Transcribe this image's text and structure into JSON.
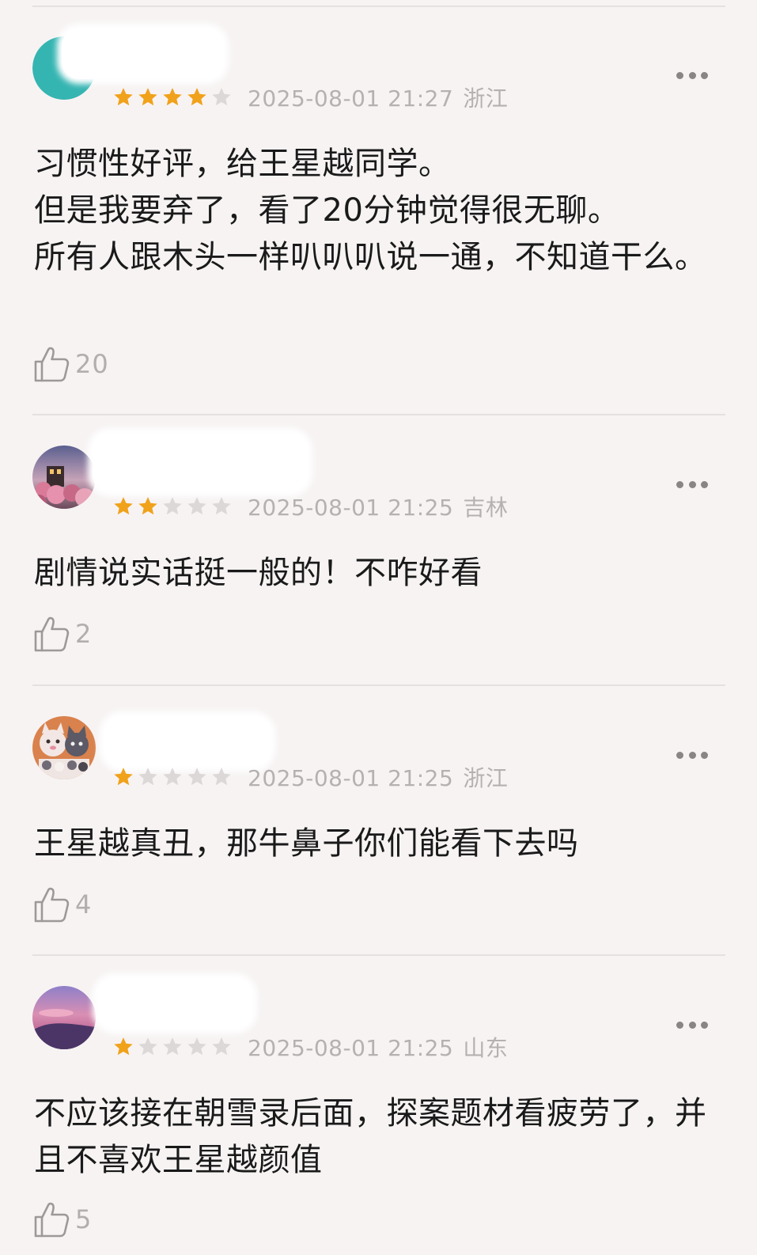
{
  "colors": {
    "background": "#f7f3f3",
    "star_filled": "#f0a21a",
    "star_empty": "#dcd8d8",
    "meta_text": "#b6b1b1",
    "divider": "#e6e0e0"
  },
  "comments": [
    {
      "avatar": "teal-avatar",
      "rating": 4,
      "max_rating": 5,
      "date": "2025-08-01 21:27",
      "region": "浙江",
      "text": "习惯性好评，给王星越同学。\n但是我要弃了，看了20分钟觉得很无聊。\n所有人跟木头一样叭叭叭说一通，不知道干么。",
      "likes": "20"
    },
    {
      "avatar": "garden-photo-avatar",
      "rating": 2,
      "max_rating": 5,
      "date": "2025-08-01 21:25",
      "region": "吉林",
      "text": "剧情说实话挺一般的！不咋好看",
      "likes": "2"
    },
    {
      "avatar": "cartoon-characters-avatar",
      "rating": 1,
      "max_rating": 5,
      "date": "2025-08-01 21:25",
      "region": "浙江",
      "text": "王星越真丑，那牛鼻子你们能看下去吗",
      "likes": "4"
    },
    {
      "avatar": "sunset-sky-avatar",
      "rating": 1,
      "max_rating": 5,
      "date": "2025-08-01 21:25",
      "region": "山东",
      "text": "不应该接在朝雪录后面，探案题材看疲劳了，并且不喜欢王星越颜值",
      "likes": "5"
    }
  ]
}
